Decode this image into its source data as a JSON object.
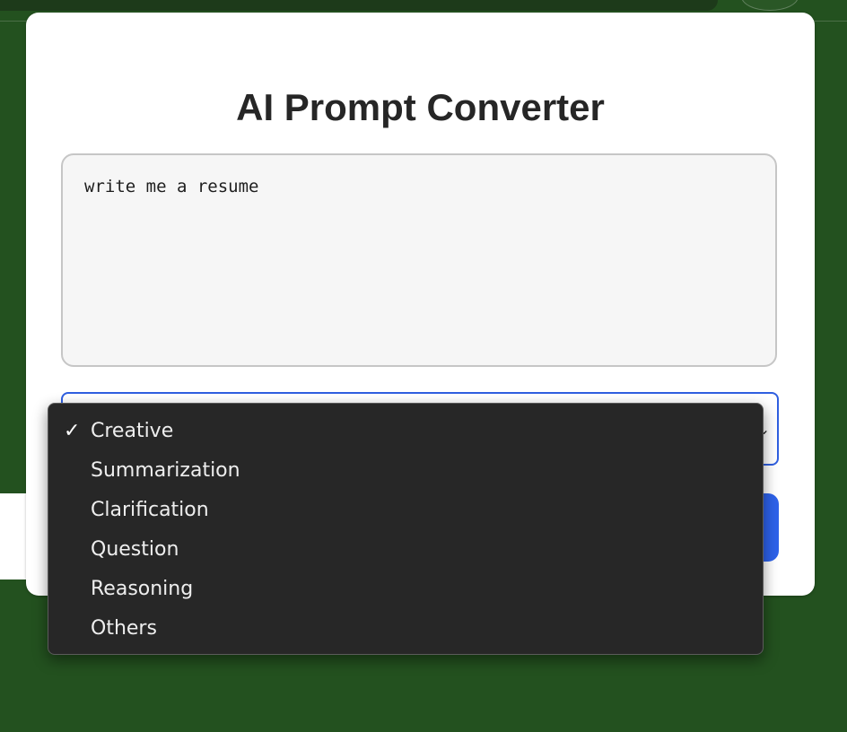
{
  "page": {
    "title": "AI Prompt Converter"
  },
  "prompt": {
    "value": "write me a resume"
  },
  "category_select": {
    "selected": "Creative",
    "caret_icon": "chevron-down-icon",
    "options": [
      {
        "label": "Creative",
        "checked": true
      },
      {
        "label": "Summarization",
        "checked": false
      },
      {
        "label": "Clarification",
        "checked": false
      },
      {
        "label": "Question",
        "checked": false
      },
      {
        "label": "Reasoning",
        "checked": false
      },
      {
        "label": "Others",
        "checked": false
      }
    ],
    "check_icon": "checkmark-icon"
  },
  "colors": {
    "background": "#23511f",
    "card": "#ffffff",
    "accent": "#2d62ea",
    "dropdown_bg": "#272727"
  }
}
